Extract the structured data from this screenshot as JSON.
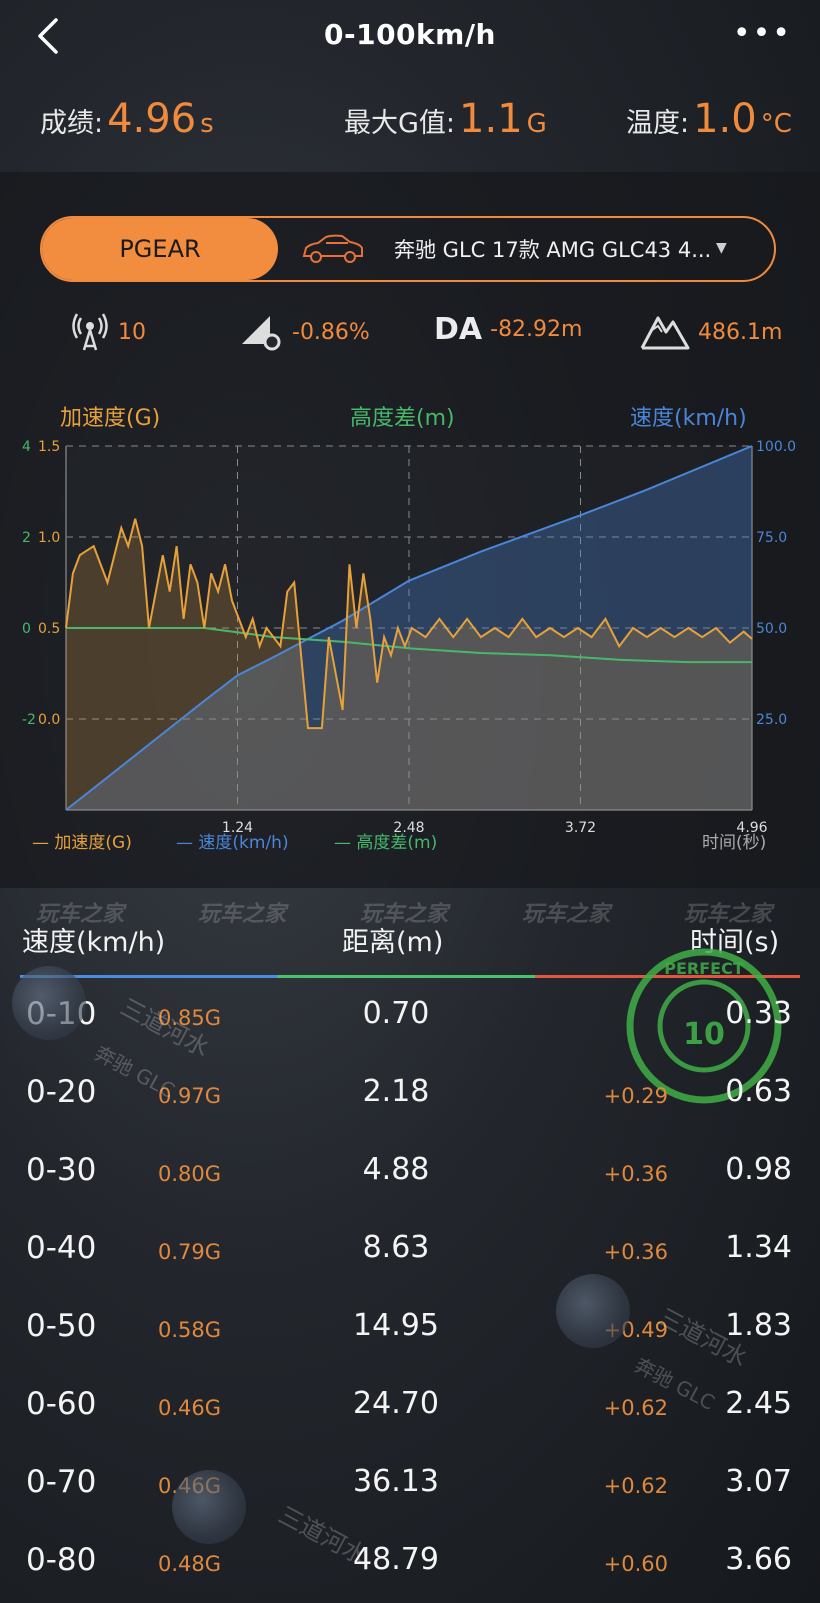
{
  "header": {
    "title": "0-100km/h"
  },
  "stats": {
    "score_label": "成绩:",
    "score_value": "4.96",
    "score_unit": "s",
    "maxg_label": "最大G值:",
    "maxg_value": "1.1",
    "maxg_unit": "G",
    "temp_label": "温度:",
    "temp_value": "1.0",
    "temp_unit": "°C"
  },
  "device": {
    "brand": "PGEAR",
    "car_name": "奔驰 GLC 17款 AMG GLC43 4..."
  },
  "sensors": {
    "satellites": "10",
    "slope": "-0.86%",
    "da_label": "DA",
    "da_value": "-82.92m",
    "altitude": "486.1m"
  },
  "chart_labels": {
    "accel": "加速度(G)",
    "height": "高度差(m)",
    "speed": "速度(km/h)",
    "legend_accel": "— 加速度(G)",
    "legend_speed": "— 速度(km/h)",
    "legend_height": "— 高度差(m)",
    "time_axis": "时间(秒)"
  },
  "chart_data": {
    "type": "line",
    "x_ticks": [
      "1.24",
      "2.48",
      "3.72",
      "4.96"
    ],
    "xlim": [
      0,
      4.96
    ],
    "xlabel": "时间(秒)",
    "y_left_height_ticks": [
      "4",
      "2",
      "0",
      "-2"
    ],
    "y_left_accel_ticks": [
      "1.5",
      "1.0",
      "0.5",
      "0.0"
    ],
    "y_right_speed_ticks": [
      "100.0",
      "75.0",
      "50.0",
      "25.0"
    ],
    "accel_ylim": [
      -0.5,
      1.5
    ],
    "speed_ylim": [
      0,
      100
    ],
    "height_ylim": [
      -4,
      4
    ],
    "series": [
      {
        "name": "加速度(G)",
        "color": "#e6a13a",
        "x": [
          0,
          0.05,
          0.1,
          0.2,
          0.3,
          0.4,
          0.45,
          0.5,
          0.55,
          0.6,
          0.7,
          0.75,
          0.8,
          0.85,
          0.9,
          0.95,
          1.0,
          1.05,
          1.1,
          1.15,
          1.2,
          1.25,
          1.3,
          1.35,
          1.4,
          1.45,
          1.55,
          1.6,
          1.65,
          1.75,
          1.85,
          1.9,
          1.95,
          2.0,
          2.05,
          2.1,
          2.15,
          2.2,
          2.25,
          2.3,
          2.35,
          2.4,
          2.45,
          2.5,
          2.6,
          2.7,
          2.8,
          2.9,
          3.0,
          3.1,
          3.2,
          3.3,
          3.4,
          3.5,
          3.6,
          3.7,
          3.8,
          3.9,
          4.0,
          4.1,
          4.2,
          4.3,
          4.4,
          4.5,
          4.6,
          4.7,
          4.8,
          4.9,
          4.96
        ],
        "values": [
          0.5,
          0.8,
          0.9,
          0.95,
          0.75,
          1.05,
          0.95,
          1.1,
          0.95,
          0.5,
          0.9,
          0.7,
          0.95,
          0.55,
          0.85,
          0.75,
          0.5,
          0.8,
          0.7,
          0.85,
          0.65,
          0.55,
          0.45,
          0.55,
          0.4,
          0.5,
          0.4,
          0.7,
          0.75,
          -0.05,
          -0.05,
          0.45,
          0.25,
          0.05,
          0.85,
          0.5,
          0.8,
          0.55,
          0.2,
          0.45,
          0.35,
          0.5,
          0.4,
          0.5,
          0.45,
          0.55,
          0.45,
          0.55,
          0.45,
          0.5,
          0.45,
          0.55,
          0.45,
          0.5,
          0.45,
          0.5,
          0.45,
          0.55,
          0.4,
          0.5,
          0.45,
          0.5,
          0.45,
          0.5,
          0.45,
          0.5,
          0.42,
          0.48,
          0.44
        ]
      },
      {
        "name": "速度(km/h)",
        "color": "#4a86d8",
        "x": [
          0,
          0.5,
          1.0,
          1.24,
          1.5,
          2.0,
          2.48,
          3.0,
          3.72,
          4.2,
          4.96
        ],
        "values": [
          0,
          15,
          30,
          37,
          42,
          52,
          63,
          71,
          81,
          88,
          100
        ]
      },
      {
        "name": "高度差(m)",
        "color": "#47b86a",
        "x": [
          0,
          1.0,
          1.5,
          2.0,
          2.5,
          3.0,
          3.5,
          4.0,
          4.5,
          4.96
        ],
        "values": [
          0,
          0,
          -0.2,
          -0.3,
          -0.45,
          -0.55,
          -0.6,
          -0.7,
          -0.75,
          -0.75
        ]
      }
    ]
  },
  "watermarks": [
    "玩车之家",
    "玩车之家",
    "玩车之家",
    "玩车之家",
    "玩车之家"
  ],
  "table": {
    "col_speed": "速度(km/h)",
    "col_distance": "距离(m)",
    "col_time": "时间(s)",
    "rows": [
      {
        "range": "0-10",
        "g": "0.85G",
        "dist": "0.70",
        "delta": "",
        "time": "0.33"
      },
      {
        "range": "0-20",
        "g": "0.97G",
        "dist": "2.18",
        "delta": "+0.29",
        "time": "0.63"
      },
      {
        "range": "0-30",
        "g": "0.80G",
        "dist": "4.88",
        "delta": "+0.36",
        "time": "0.98"
      },
      {
        "range": "0-40",
        "g": "0.79G",
        "dist": "8.63",
        "delta": "+0.36",
        "time": "1.34"
      },
      {
        "range": "0-50",
        "g": "0.58G",
        "dist": "14.95",
        "delta": "+0.49",
        "time": "1.83"
      },
      {
        "range": "0-60",
        "g": "0.46G",
        "dist": "24.70",
        "delta": "+0.62",
        "time": "2.45"
      },
      {
        "range": "0-70",
        "g": "0.46G",
        "dist": "36.13",
        "delta": "+0.62",
        "time": "3.07"
      },
      {
        "range": "0-80",
        "g": "0.48G",
        "dist": "48.79",
        "delta": "+0.60",
        "time": "3.66"
      }
    ]
  },
  "stamp": {
    "text": "PERFECT",
    "score": "10"
  },
  "overlay_text": {
    "line1": "三道河水",
    "line2": "奔驰 GLC"
  },
  "colors": {
    "accent": "#f08a3c",
    "speed": "#4a86d8",
    "height": "#47b86a",
    "accel": "#e6a13a"
  }
}
